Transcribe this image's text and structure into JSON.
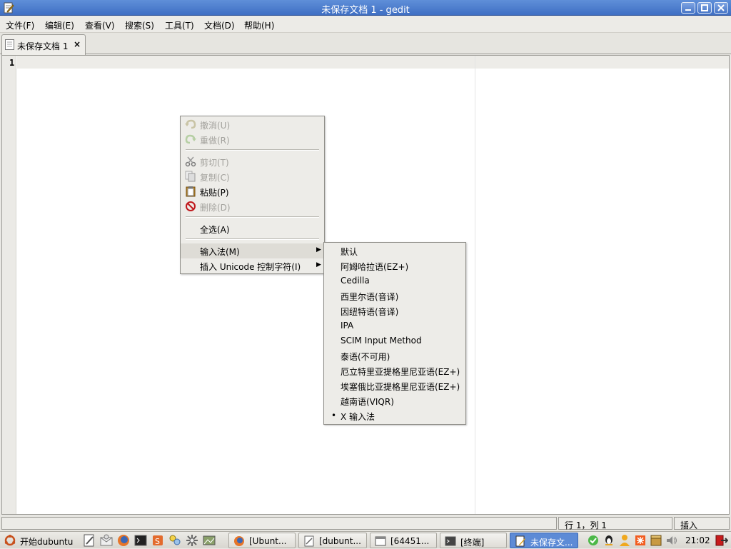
{
  "window": {
    "title": "未保存文档 1 - gedit"
  },
  "menubar": {
    "items": [
      "文件(F)",
      "编辑(E)",
      "查看(V)",
      "搜索(S)",
      "工具(T)",
      "文档(D)",
      "帮助(H)"
    ]
  },
  "tabs": [
    {
      "label": "未保存文档 1",
      "close": "×"
    }
  ],
  "editor": {
    "line_number": "1"
  },
  "context_menu": {
    "items": [
      {
        "label": "撤消(U)",
        "icon": "undo-icon",
        "disabled": true
      },
      {
        "label": "重做(R)",
        "icon": "redo-icon",
        "disabled": true
      },
      {
        "label": "剪切(T)",
        "icon": "cut-icon",
        "disabled": true
      },
      {
        "label": "复制(C)",
        "icon": "copy-icon",
        "disabled": true
      },
      {
        "label": "粘贴(P)",
        "icon": "paste-icon",
        "disabled": false
      },
      {
        "label": "删除(D)",
        "icon": "delete-icon",
        "disabled": true
      },
      {
        "label": "全选(A)",
        "disabled": false
      },
      {
        "label": "输入法(M)",
        "submenu": true
      },
      {
        "label": "插入 Unicode 控制字符(I)",
        "submenu": true
      }
    ]
  },
  "input_method_submenu": {
    "items": [
      "默认",
      "阿姆哈拉语(EZ+)",
      "Cedilla",
      "西里尔语(音译)",
      "因纽特语(音译)",
      "IPA",
      "SCIM Input Method",
      "泰语(不可用)",
      "厄立特里亚提格里尼亚语(EZ+)",
      "埃塞俄比亚提格里尼亚语(EZ+)",
      "越南语(VIQR)",
      "X 输入法"
    ],
    "selected": "X 输入法",
    "bullet": "•"
  },
  "statusbar": {
    "position": "行 1，列 1",
    "mode": "插入"
  },
  "taskbar": {
    "start_label": "开始dubuntu",
    "tasks": [
      {
        "label": "[Ubunt...",
        "icon": "firefox-icon"
      },
      {
        "label": "[dubunt...",
        "icon": "document-icon"
      },
      {
        "label": "[64451...",
        "icon": "window-icon"
      },
      {
        "label": "[终端]",
        "icon": "terminal-icon"
      },
      {
        "label": "未保存文...",
        "icon": "gedit-icon",
        "active": true
      }
    ],
    "clock": "21:02"
  },
  "colors": {
    "titlebar": "#4a7bcb",
    "active_task": "#5d8bd6"
  }
}
